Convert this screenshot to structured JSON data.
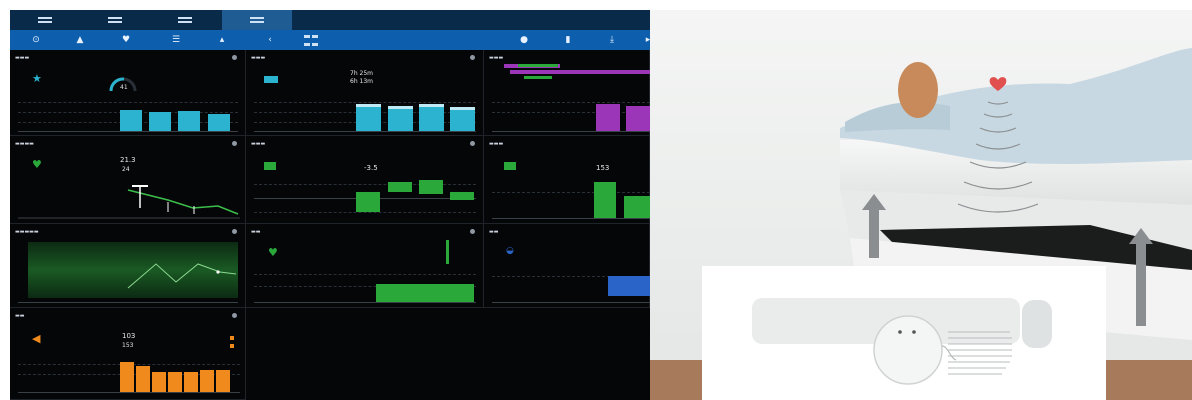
{
  "dashboard": {
    "colors": {
      "nav": "#0a2a4a",
      "nav_active": "#1f5c94",
      "iconbar": "#0d5fae",
      "background": "#050608",
      "cyan": "#2bb3cf",
      "green": "#2aa83a",
      "purple": "#9b36b8",
      "orange": "#f08a1c",
      "blue": "#2a64c8"
    },
    "top_tabs_count": 4,
    "active_tab": 3,
    "panels": [
      {
        "id": "sleep-score",
        "icon": "star-icon",
        "value": "41"
      },
      {
        "id": "sleep-duration",
        "icon": "bed-icon",
        "value_a": "7h 25m",
        "value_b": "6h 13m"
      },
      {
        "id": "sleep-stages",
        "icon": "bars-icon"
      },
      {
        "id": "heart-rate",
        "icon": "heart-icon",
        "value_a": "21.3",
        "value_b": "24"
      },
      {
        "id": "hrv",
        "icon": "bed-icon",
        "value": "-3.5"
      },
      {
        "id": "hrv-2",
        "icon": "bed-icon",
        "value": "153"
      },
      {
        "id": "stress",
        "icon": "wave-icon"
      },
      {
        "id": "heart-rate-2",
        "icon": "heart-icon"
      },
      {
        "id": "breathing",
        "icon": "lungs-icon"
      },
      {
        "id": "snoring",
        "icon": "speaker-icon",
        "value_a": "103",
        "value_b": "153"
      }
    ]
  },
  "photo": {
    "subject": "bed-with-sleep-sensor",
    "colors": {
      "wall": "#eef0ef",
      "floor": "#a87a5c",
      "bedding": "#c8d8e2",
      "heart": "#e0504e",
      "arrow": "#8a8e90"
    }
  }
}
